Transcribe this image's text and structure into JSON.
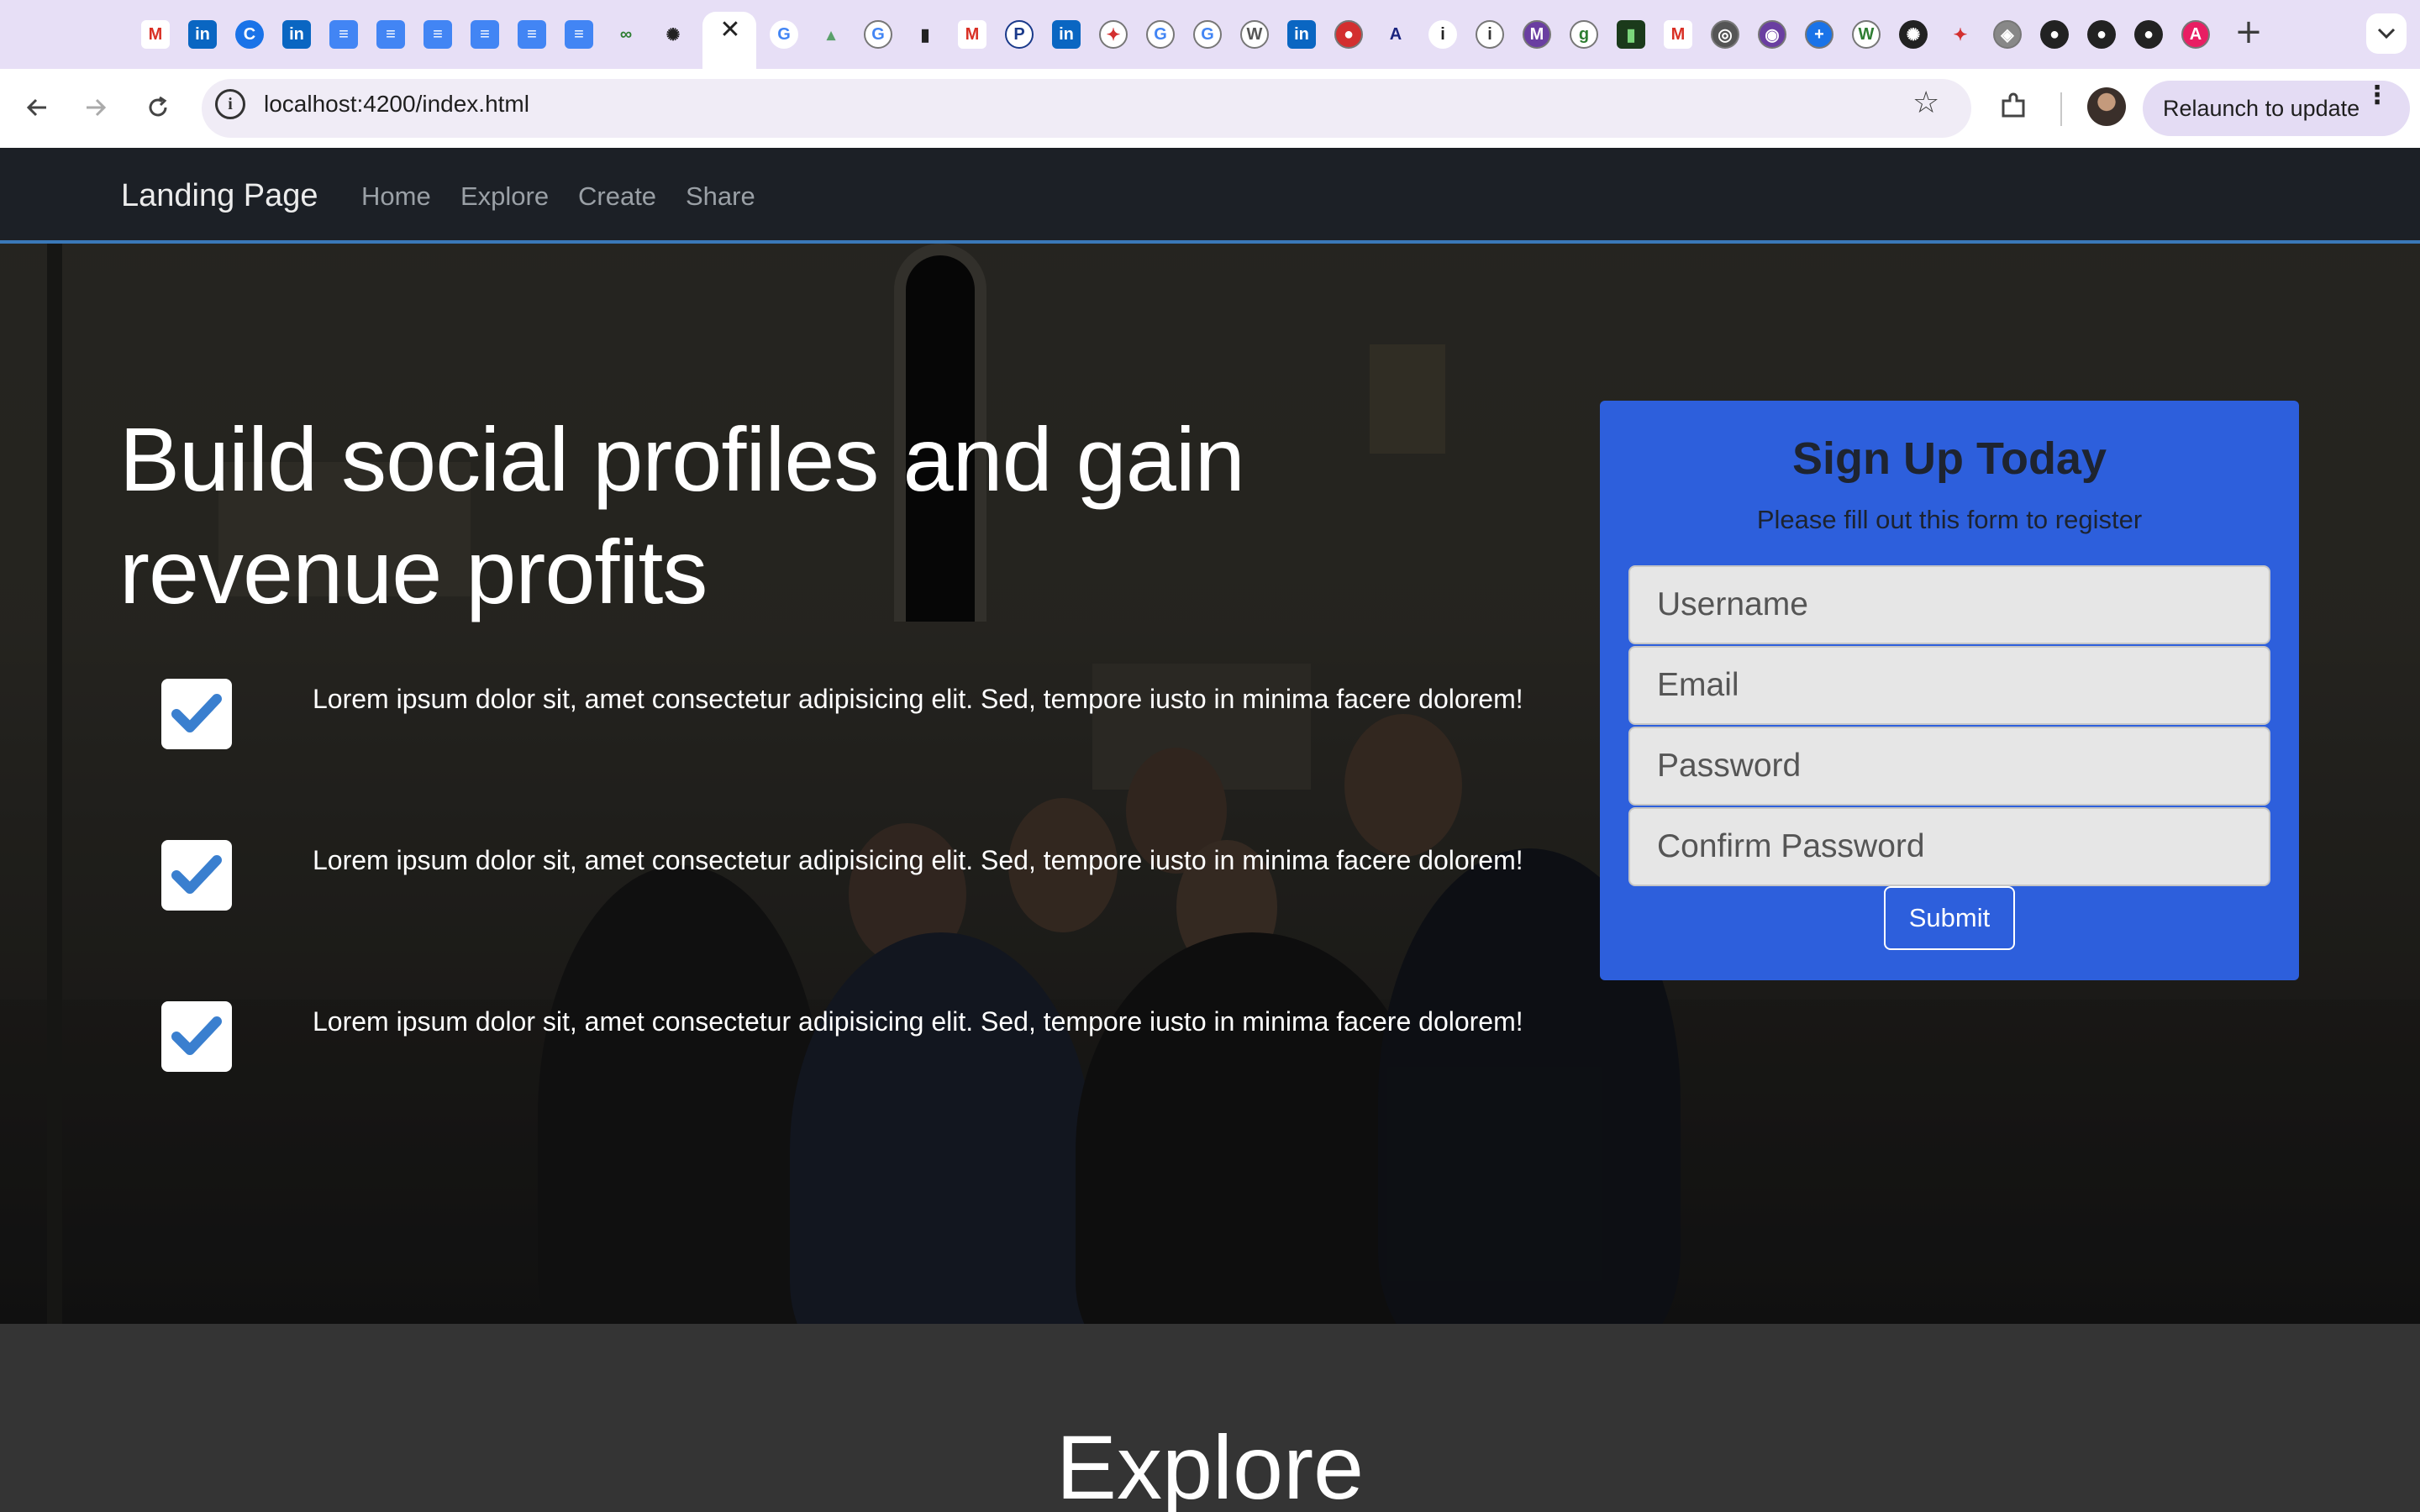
{
  "browser": {
    "url": "localhost:4200/index.html",
    "relaunch_label": "Relaunch to update",
    "tab_icons": [
      "gmail-icon",
      "linkedin-icon",
      "c-icon",
      "linkedin-icon",
      "google-docs-icon",
      "google-docs-icon",
      "google-docs-icon",
      "google-docs-icon",
      "google-docs-icon",
      "google-docs-icon",
      "link-icon",
      "openai-icon",
      "google-icon",
      "chart-icon",
      "google-icon",
      "bookmark-icon",
      "gmail-icon",
      "p-icon",
      "linkedin-icon",
      "maple-leaf-icon",
      "google-icon",
      "google-icon",
      "w-icon",
      "linkedin-icon",
      "red-icon",
      "a-icon",
      "info-icon",
      "i-icon",
      "m-icon",
      "g-icon",
      "green-icon",
      "gmail-icon",
      "globe-icon",
      "purple-icon",
      "blue-icon",
      "w-icon",
      "openai-icon",
      "maple-leaf-icon",
      "shield-icon",
      "github-icon",
      "github-icon",
      "github-icon",
      "a-icon"
    ]
  },
  "navbar": {
    "brand": "Landing Page",
    "links": [
      "Home",
      "Explore",
      "Create",
      "Share"
    ]
  },
  "hero": {
    "headline": "Build social profiles and gain revenue profits",
    "features": [
      "Lorem ipsum dolor sit, amet consectetur adipisicing elit. Sed, tempore iusto in minima facere dolorem!",
      "Lorem ipsum dolor sit, amet consectetur adipisicing elit. Sed, tempore iusto in minima facere dolorem!",
      "Lorem ipsum dolor sit, amet consectetur adipisicing elit. Sed, tempore iusto in minima facere dolorem!"
    ]
  },
  "signup": {
    "title": "Sign Up Today",
    "subtitle": "Please fill out this form to register",
    "fields": {
      "username": "Username",
      "email": "Email",
      "password": "Password",
      "confirm": "Confirm Password"
    },
    "submit_label": "Submit"
  },
  "explore": {
    "title": "Explore"
  },
  "colors": {
    "accent": "#2d5fdc",
    "navbar": "#1c2026",
    "check": "#3a7fcf"
  }
}
